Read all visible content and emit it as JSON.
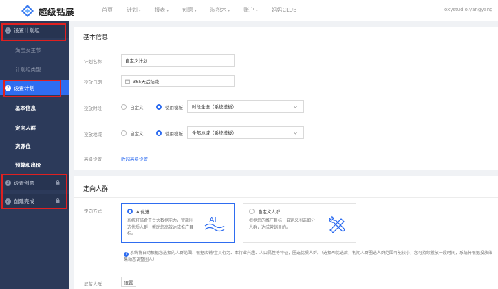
{
  "header": {
    "logo_text": "超级钻展",
    "nav": [
      {
        "label": "首页",
        "caret": false
      },
      {
        "label": "计划",
        "caret": true
      },
      {
        "label": "报表",
        "caret": true
      },
      {
        "label": "创意",
        "caret": true
      },
      {
        "label": "淘积木",
        "caret": true
      },
      {
        "label": "账户",
        "caret": true
      },
      {
        "label": "妈妈CLUB",
        "caret": false
      }
    ],
    "user": "oxystudio.yangyang"
  },
  "sidebar": {
    "step1": {
      "num": "1",
      "label": "设置计划组"
    },
    "step1_items": [
      "淘宝女王节",
      "计划组类型"
    ],
    "step2": {
      "num": "2",
      "label": "设置计划"
    },
    "step2_items": [
      "基本信息",
      "定向人群",
      "资源位",
      "预算和出价"
    ],
    "step3": {
      "num": "3",
      "label": "设置创意"
    },
    "step4": {
      "num": "✓",
      "label": "创建完成"
    }
  },
  "basic": {
    "title": "基本信息",
    "name_label": "计划名称",
    "name_value": "自定义计划",
    "date_label": "投放日期",
    "date_value": "365天后结束",
    "time_label": "投放时段",
    "time_custom": "自定义",
    "time_template": "使用模板",
    "time_select": "时段全选（系统模板）",
    "region_label": "投放地域",
    "region_custom": "自定义",
    "region_template": "使用模板",
    "region_select": "全部地域（系统模板）",
    "advanced_label": "高级设置",
    "advanced_link": "收起高级设置"
  },
  "audience": {
    "title": "定向人群",
    "method_label": "定向方式",
    "ai_title": "AI优选",
    "ai_desc": "系统将结合平台大数据能力，智能圈选优质人群，帮助您高效达成推广目标。",
    "custom_title": "自定义人群",
    "custom_desc": "根据您的推广目标，自定义圈选细分人群，达成营销目的。",
    "notice": "系统将自动根据您选择的人群范围、根据店铺/宝贝行为、本行业兴趣、人口属性等特征，圈选优质人群。（选择AI优选后，初期人群圈选人群范围可能较小，您可持续投放一段时间，系统将根据投放效果动态调整圈人）",
    "shield_label": "屏蔽人群",
    "shield_button": "设置"
  },
  "colors": {
    "accent": "#2f6df0",
    "sidebar": "#2c3a5a",
    "highlight": "#e02020"
  }
}
